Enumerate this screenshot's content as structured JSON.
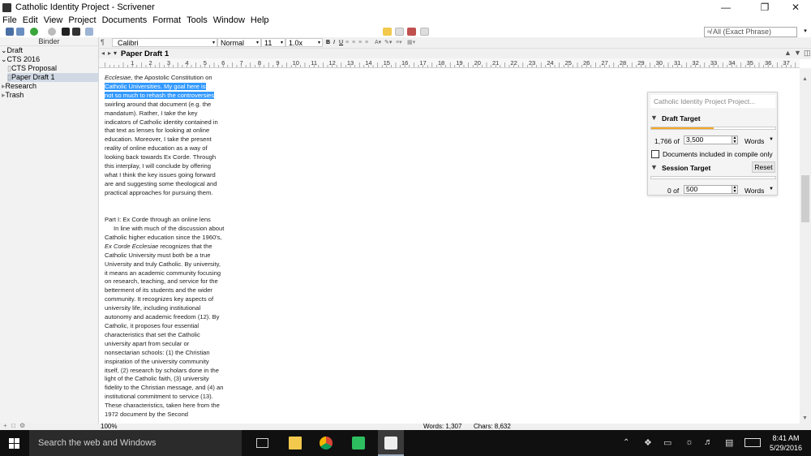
{
  "window": {
    "title": "Catholic Identity Project - Scrivener"
  },
  "menu": [
    "File",
    "Edit",
    "View",
    "Project",
    "Documents",
    "Format",
    "Tools",
    "Window",
    "Help"
  ],
  "search": {
    "value": "All (Exact Phrase)"
  },
  "binder": {
    "header": "Binder",
    "items": [
      {
        "label": "Draft"
      },
      {
        "label": "CTS 2016"
      },
      {
        "label": "CTS Proposal"
      },
      {
        "label": "Paper Draft 1"
      },
      {
        "label": "Research"
      },
      {
        "label": "Trash"
      }
    ]
  },
  "format_bar": {
    "font": "Calibri",
    "style": "Normal",
    "size": "11",
    "spacing": "1.0x"
  },
  "document": {
    "title": "Paper Draft 1"
  },
  "ruler_numbers": [
    "1",
    "2",
    "3",
    "4",
    "5",
    "6",
    "7",
    "8",
    "9",
    "10",
    "11",
    "12",
    "13",
    "14",
    "15",
    "16",
    "17",
    "18",
    "19",
    "20",
    "21",
    "22",
    "23",
    "24",
    "25",
    "26",
    "27",
    "28",
    "29",
    "30",
    "31",
    "32",
    "33",
    "34",
    "35",
    "36",
    "37"
  ],
  "editor": {
    "p1_italic": "Ecclesiae",
    "p1_lead": ", the Apostolic Constitution on",
    "p1_hl1": "Catholic Universities.  My goal here is",
    "p1_hl2": "not so much to rehash the controversies",
    "p1_rest": "swirling around that document (e.g. the mandatum).  Rather, I take the key indicators of Catholic identity contained in that text as lenses for looking at online education.  Moreover, I take the present reality of online education as a way of looking back towards Ex Corde.  Through this interplay, I will conclude by offering what I think the key issues going forward are and suggesting some theological and practical approaches for pursuing them.",
    "heading": "Part I: Ex Corde through an online lens",
    "p2_a": "In line with much of the discussion about Catholic higher education since the 1960's, ",
    "p2_italic": "Ex Corde Ecclesiae",
    "p2_b": " recognizes that the Catholic University must both be a true University and truly Catholic.  By university, it means  an academic community focusing on research, teaching, and service for the betterment of its students and the wider community.  It recognizes key aspects of university life, including institutional autonomy and academic freedom (12).  By Catholic, it proposes four essential characteristics that set the Catholic university apart from secular or nonsectarian schools: (1) the Christian inspiration of the university community itself, (2) research by scholars done in the light of the Catholic faith, (3) university fidelity to the Christian message, and (4) an institutional commitment to service (13).  These characteristics, taken here from the 1972 document by the Second"
  },
  "targets": {
    "title": "Catholic Identity Project Project...",
    "draft_label": "Draft Target",
    "draft_current": "1,766 of",
    "draft_goal": "3,500",
    "draft_progress": 0.505,
    "draft_unit": "Words",
    "compile_label": "Documents included in compile only",
    "session_label": "Session Target",
    "reset_label": "Reset",
    "session_current": "0 of",
    "session_goal": "500",
    "session_progress": 0,
    "session_unit": "Words"
  },
  "status": {
    "zoom": "100%",
    "words": "Words: 1,307",
    "chars": "Chars: 8,632"
  },
  "taskbar": {
    "search_placeholder": "Search the web and Windows",
    "time": "8:41 AM",
    "date": "5/29/2016"
  },
  "colors": {
    "selection": "#3399ff",
    "progress": "#f5a623",
    "taskbar": "#101010"
  }
}
